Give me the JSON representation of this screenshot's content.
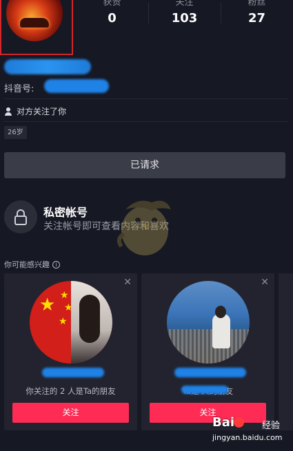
{
  "profile": {
    "stats": [
      {
        "label": "获赞",
        "value": "0"
      },
      {
        "label": "关注",
        "value": "103"
      },
      {
        "label": "粉丝",
        "value": "27"
      }
    ],
    "douyin_id_label": "抖音号:",
    "follow_note": "对方关注了你",
    "age": "26岁",
    "request_button": "已请求"
  },
  "private_account": {
    "title": "私密帐号",
    "description": "关注帐号即可查看内容和喜欢"
  },
  "suggestions": {
    "label": "你可能感兴趣",
    "cards": [
      {
        "reason": "你关注的 2 人是Ta的朋友",
        "follow_label": "关注"
      },
      {
        "reason": "Ta是                    人的朋友",
        "follow_label": "关注"
      }
    ]
  },
  "watermark": {
    "brand": "Bai",
    "cn": "经验",
    "url": "jingyan.baidu.com"
  },
  "colors": {
    "background": "#161823",
    "accent": "#fe2c55",
    "highlight_box": "#d4262b"
  }
}
